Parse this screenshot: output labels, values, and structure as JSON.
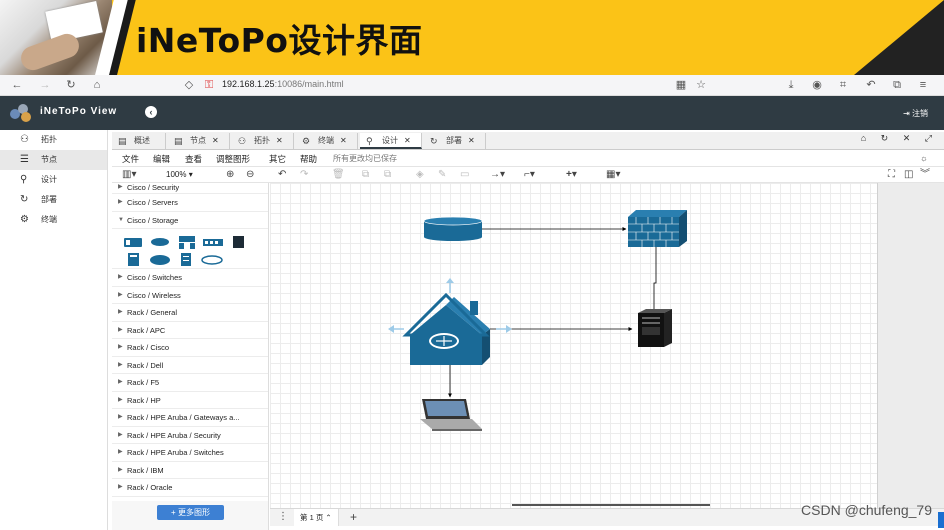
{
  "slide": {
    "title": "iNeToPo设计界面"
  },
  "browser": {
    "url_host": "192.168.1.25",
    "url_rest": ":10086/main.html"
  },
  "app": {
    "title": "iNeToPo View",
    "logout_label": "注销"
  },
  "sidebar": {
    "items": [
      {
        "label": "拓扑",
        "icon": "topology-icon"
      },
      {
        "label": "节点",
        "icon": "list-icon"
      },
      {
        "label": "设计",
        "icon": "design-icon"
      },
      {
        "label": "部署",
        "icon": "deploy-icon"
      },
      {
        "label": "终端",
        "icon": "terminal-icon"
      }
    ]
  },
  "tabs": [
    {
      "label": "概述"
    },
    {
      "label": "节点"
    },
    {
      "label": "拓扑"
    },
    {
      "label": "终端"
    },
    {
      "label": "设计"
    },
    {
      "label": "部署"
    }
  ],
  "menu": {
    "items": [
      "文件",
      "编辑",
      "查看",
      "调整图形",
      "其它",
      "帮助"
    ],
    "status": "所有更改均已保存"
  },
  "toolbar": {
    "zoom": "100%"
  },
  "library": {
    "items_top": [
      "Cisco / Security",
      "Cisco / Servers",
      "Cisco / Storage"
    ],
    "items_bottom": [
      "Cisco / Switches",
      "Cisco / Wireless",
      "Rack / General",
      "Rack / APC",
      "Rack / Cisco",
      "Rack / Dell",
      "Rack / F5",
      "Rack / HP",
      "Rack / HPE Aruba / Gateways a...",
      "Rack / HPE Aruba / Security",
      "Rack / HPE Aruba / Switches",
      "Rack / IBM",
      "Rack / Oracle"
    ],
    "more_button": "+ 更多图形"
  },
  "pages": {
    "current": "第 1 页"
  },
  "watermark": "CSDN @chufeng_79",
  "colors": {
    "accent": "#fbc317",
    "header": "#2f3b43",
    "cisco_blue": "#1a6a97",
    "button_blue": "#3d80d3"
  }
}
